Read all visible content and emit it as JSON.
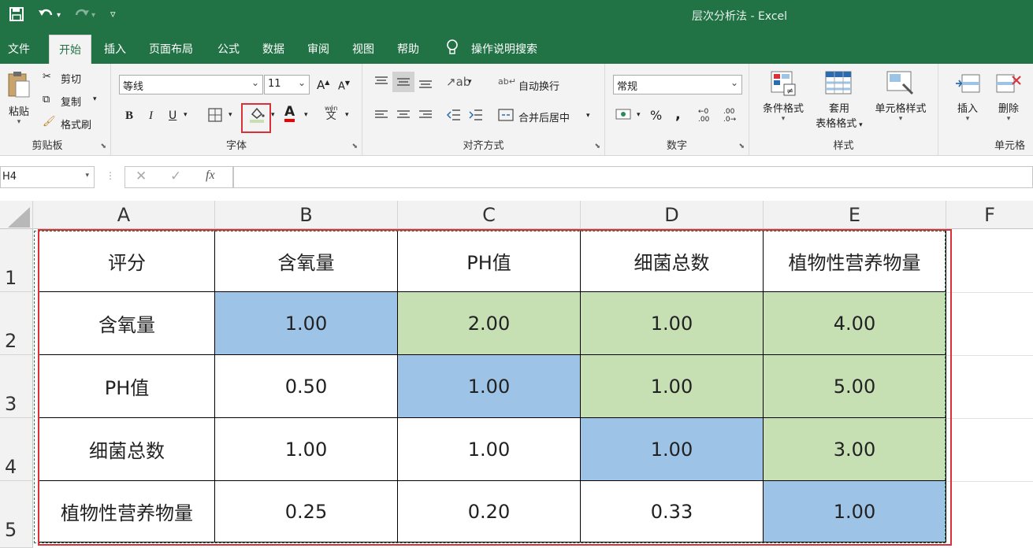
{
  "window": {
    "title": "层次分析法  -  Excel"
  },
  "menu_tabs": [
    "文件",
    "开始",
    "插入",
    "页面布局",
    "公式",
    "数据",
    "审阅",
    "视图",
    "帮助"
  ],
  "search_label": "操作说明搜索",
  "clipboard": {
    "paste": "粘贴",
    "cut": "剪切",
    "copy": "复制",
    "format_painter": "格式刷",
    "group": "剪贴板"
  },
  "font": {
    "name": "等线",
    "size": "11",
    "bold": "B",
    "italic": "I",
    "underline": "U",
    "color_letter": "A",
    "wen": "wén",
    "wen_char": "文",
    "group": "字体",
    "increase": "A",
    "decrease": "A"
  },
  "alignment": {
    "wrap": "自动换行",
    "merge": "合并后居中",
    "group": "对齐方式"
  },
  "number": {
    "format": "常规",
    "percent": "%",
    "comma": ",",
    "inc": ".00",
    "dec": ".0",
    "group": "数字"
  },
  "styles": {
    "conditional": "条件格式",
    "table1": "套用",
    "table2": "表格格式",
    "cell_styles": "单元格样式",
    "group": "样式"
  },
  "cells": {
    "insert": "插入",
    "delete": "删除",
    "group": "单元格"
  },
  "formula_bar": {
    "name_box": "H4",
    "fx": "fx"
  },
  "columns": [
    "A",
    "B",
    "C",
    "D",
    "E",
    "F"
  ],
  "rows": [
    "1",
    "2",
    "3",
    "4",
    "5"
  ],
  "table": [
    [
      "评分",
      "含氧量",
      "PH值",
      "细菌总数",
      "植物性营养物量"
    ],
    [
      "含氧量",
      "1.00",
      "2.00",
      "1.00",
      "4.00"
    ],
    [
      "PH值",
      "0.50",
      "1.00",
      "1.00",
      "5.00"
    ],
    [
      "细菌总数",
      "1.00",
      "1.00",
      "1.00",
      "3.00"
    ],
    [
      "植物性营养物量",
      "0.25",
      "0.20",
      "0.33",
      "1.00"
    ]
  ],
  "colors": {
    "excel_green": "#217346",
    "blue_fill": "#9dc3e6",
    "green_fill": "#c6e0b4",
    "highlight_red": "#d9303a"
  }
}
